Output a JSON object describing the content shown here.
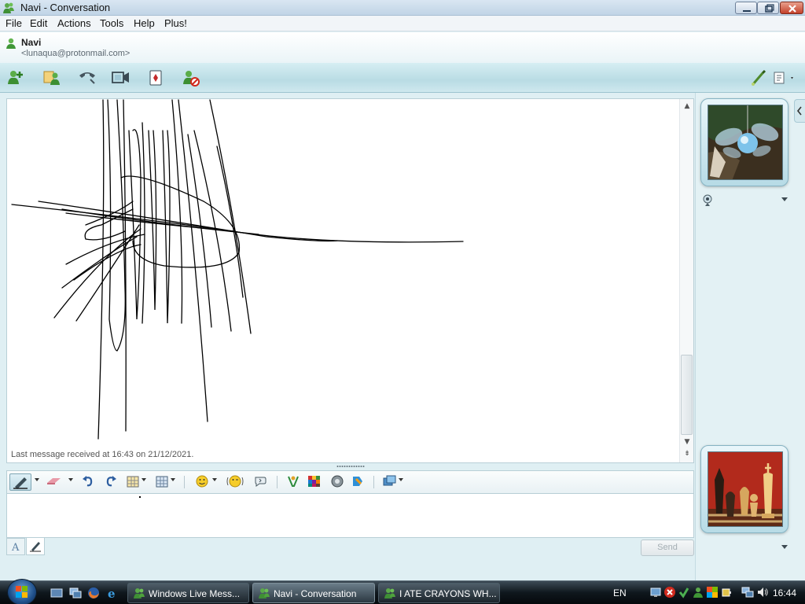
{
  "window": {
    "title": "Navi - Conversation"
  },
  "menu": [
    "File",
    "Edit",
    "Actions",
    "Tools",
    "Help",
    "Plus!"
  ],
  "contact": {
    "name": "Navi",
    "email": "<lunaqua@protonmail.com>"
  },
  "toolbar": {
    "icons": [
      "invite-contact-icon",
      "share-files-icon",
      "call-icon",
      "video-call-icon",
      "games-icon",
      "block-contact-icon"
    ],
    "right_icons": [
      "background-icon",
      "display-options-icon"
    ]
  },
  "history": {
    "last_message": "Last message received at 16:43 on 21/12/2021."
  },
  "compose": {
    "toolbar_icons": [
      "pen-tool-icon",
      "eraser-icon",
      "undo-icon",
      "redo-icon",
      "stamp-grid-icon",
      "background-grid-icon",
      "emoticon-icon",
      "wink-icon",
      "nudge-icon",
      "voice-clip-icon",
      "color-palette-icon",
      "ink-sound-icon",
      "tools-icon",
      "more-options-icon"
    ],
    "input_value": "",
    "send_label": "Send"
  },
  "colors": {
    "accent": "#cfe8ee",
    "taskbar": "#0f171d",
    "send_disabled": "#a4aeb3"
  },
  "taskbar": {
    "tasks": [
      {
        "label": "Windows Live Mess...",
        "active": false
      },
      {
        "label": "Navi - Conversation",
        "active": true
      },
      {
        "label": "I ATE CRAYONS WH...",
        "active": false
      }
    ],
    "language": "EN",
    "clock": "16:44"
  }
}
